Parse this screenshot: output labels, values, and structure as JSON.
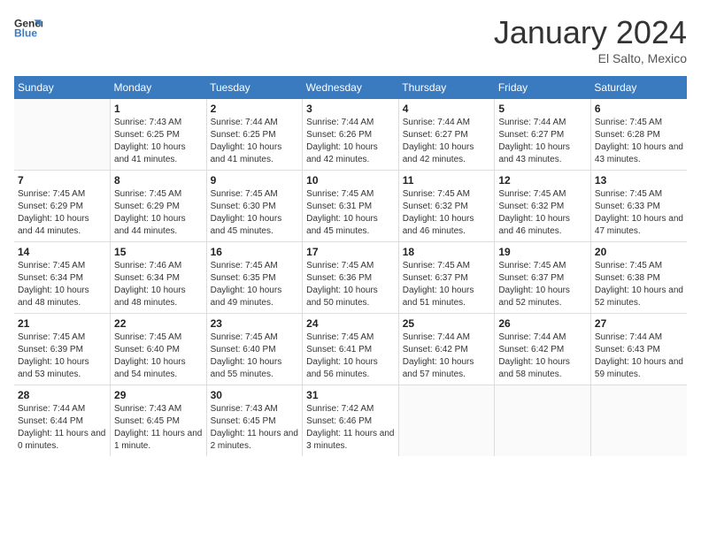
{
  "logo": {
    "line1": "General",
    "line2": "Blue"
  },
  "title": "January 2024",
  "subtitle": "El Salto, Mexico",
  "days_of_week": [
    "Sunday",
    "Monday",
    "Tuesday",
    "Wednesday",
    "Thursday",
    "Friday",
    "Saturday"
  ],
  "weeks": [
    [
      {
        "day": "",
        "sunrise": "",
        "sunset": "",
        "daylight": ""
      },
      {
        "day": "1",
        "sunrise": "Sunrise: 7:43 AM",
        "sunset": "Sunset: 6:25 PM",
        "daylight": "Daylight: 10 hours and 41 minutes."
      },
      {
        "day": "2",
        "sunrise": "Sunrise: 7:44 AM",
        "sunset": "Sunset: 6:25 PM",
        "daylight": "Daylight: 10 hours and 41 minutes."
      },
      {
        "day": "3",
        "sunrise": "Sunrise: 7:44 AM",
        "sunset": "Sunset: 6:26 PM",
        "daylight": "Daylight: 10 hours and 42 minutes."
      },
      {
        "day": "4",
        "sunrise": "Sunrise: 7:44 AM",
        "sunset": "Sunset: 6:27 PM",
        "daylight": "Daylight: 10 hours and 42 minutes."
      },
      {
        "day": "5",
        "sunrise": "Sunrise: 7:44 AM",
        "sunset": "Sunset: 6:27 PM",
        "daylight": "Daylight: 10 hours and 43 minutes."
      },
      {
        "day": "6",
        "sunrise": "Sunrise: 7:45 AM",
        "sunset": "Sunset: 6:28 PM",
        "daylight": "Daylight: 10 hours and 43 minutes."
      }
    ],
    [
      {
        "day": "7",
        "sunrise": "Sunrise: 7:45 AM",
        "sunset": "Sunset: 6:29 PM",
        "daylight": "Daylight: 10 hours and 44 minutes."
      },
      {
        "day": "8",
        "sunrise": "Sunrise: 7:45 AM",
        "sunset": "Sunset: 6:29 PM",
        "daylight": "Daylight: 10 hours and 44 minutes."
      },
      {
        "day": "9",
        "sunrise": "Sunrise: 7:45 AM",
        "sunset": "Sunset: 6:30 PM",
        "daylight": "Daylight: 10 hours and 45 minutes."
      },
      {
        "day": "10",
        "sunrise": "Sunrise: 7:45 AM",
        "sunset": "Sunset: 6:31 PM",
        "daylight": "Daylight: 10 hours and 45 minutes."
      },
      {
        "day": "11",
        "sunrise": "Sunrise: 7:45 AM",
        "sunset": "Sunset: 6:32 PM",
        "daylight": "Daylight: 10 hours and 46 minutes."
      },
      {
        "day": "12",
        "sunrise": "Sunrise: 7:45 AM",
        "sunset": "Sunset: 6:32 PM",
        "daylight": "Daylight: 10 hours and 46 minutes."
      },
      {
        "day": "13",
        "sunrise": "Sunrise: 7:45 AM",
        "sunset": "Sunset: 6:33 PM",
        "daylight": "Daylight: 10 hours and 47 minutes."
      }
    ],
    [
      {
        "day": "14",
        "sunrise": "Sunrise: 7:45 AM",
        "sunset": "Sunset: 6:34 PM",
        "daylight": "Daylight: 10 hours and 48 minutes."
      },
      {
        "day": "15",
        "sunrise": "Sunrise: 7:46 AM",
        "sunset": "Sunset: 6:34 PM",
        "daylight": "Daylight: 10 hours and 48 minutes."
      },
      {
        "day": "16",
        "sunrise": "Sunrise: 7:45 AM",
        "sunset": "Sunset: 6:35 PM",
        "daylight": "Daylight: 10 hours and 49 minutes."
      },
      {
        "day": "17",
        "sunrise": "Sunrise: 7:45 AM",
        "sunset": "Sunset: 6:36 PM",
        "daylight": "Daylight: 10 hours and 50 minutes."
      },
      {
        "day": "18",
        "sunrise": "Sunrise: 7:45 AM",
        "sunset": "Sunset: 6:37 PM",
        "daylight": "Daylight: 10 hours and 51 minutes."
      },
      {
        "day": "19",
        "sunrise": "Sunrise: 7:45 AM",
        "sunset": "Sunset: 6:37 PM",
        "daylight": "Daylight: 10 hours and 52 minutes."
      },
      {
        "day": "20",
        "sunrise": "Sunrise: 7:45 AM",
        "sunset": "Sunset: 6:38 PM",
        "daylight": "Daylight: 10 hours and 52 minutes."
      }
    ],
    [
      {
        "day": "21",
        "sunrise": "Sunrise: 7:45 AM",
        "sunset": "Sunset: 6:39 PM",
        "daylight": "Daylight: 10 hours and 53 minutes."
      },
      {
        "day": "22",
        "sunrise": "Sunrise: 7:45 AM",
        "sunset": "Sunset: 6:40 PM",
        "daylight": "Daylight: 10 hours and 54 minutes."
      },
      {
        "day": "23",
        "sunrise": "Sunrise: 7:45 AM",
        "sunset": "Sunset: 6:40 PM",
        "daylight": "Daylight: 10 hours and 55 minutes."
      },
      {
        "day": "24",
        "sunrise": "Sunrise: 7:45 AM",
        "sunset": "Sunset: 6:41 PM",
        "daylight": "Daylight: 10 hours and 56 minutes."
      },
      {
        "day": "25",
        "sunrise": "Sunrise: 7:44 AM",
        "sunset": "Sunset: 6:42 PM",
        "daylight": "Daylight: 10 hours and 57 minutes."
      },
      {
        "day": "26",
        "sunrise": "Sunrise: 7:44 AM",
        "sunset": "Sunset: 6:42 PM",
        "daylight": "Daylight: 10 hours and 58 minutes."
      },
      {
        "day": "27",
        "sunrise": "Sunrise: 7:44 AM",
        "sunset": "Sunset: 6:43 PM",
        "daylight": "Daylight: 10 hours and 59 minutes."
      }
    ],
    [
      {
        "day": "28",
        "sunrise": "Sunrise: 7:44 AM",
        "sunset": "Sunset: 6:44 PM",
        "daylight": "Daylight: 11 hours and 0 minutes."
      },
      {
        "day": "29",
        "sunrise": "Sunrise: 7:43 AM",
        "sunset": "Sunset: 6:45 PM",
        "daylight": "Daylight: 11 hours and 1 minute."
      },
      {
        "day": "30",
        "sunrise": "Sunrise: 7:43 AM",
        "sunset": "Sunset: 6:45 PM",
        "daylight": "Daylight: 11 hours and 2 minutes."
      },
      {
        "day": "31",
        "sunrise": "Sunrise: 7:42 AM",
        "sunset": "Sunset: 6:46 PM",
        "daylight": "Daylight: 11 hours and 3 minutes."
      },
      {
        "day": "",
        "sunrise": "",
        "sunset": "",
        "daylight": ""
      },
      {
        "day": "",
        "sunrise": "",
        "sunset": "",
        "daylight": ""
      },
      {
        "day": "",
        "sunrise": "",
        "sunset": "",
        "daylight": ""
      }
    ]
  ]
}
